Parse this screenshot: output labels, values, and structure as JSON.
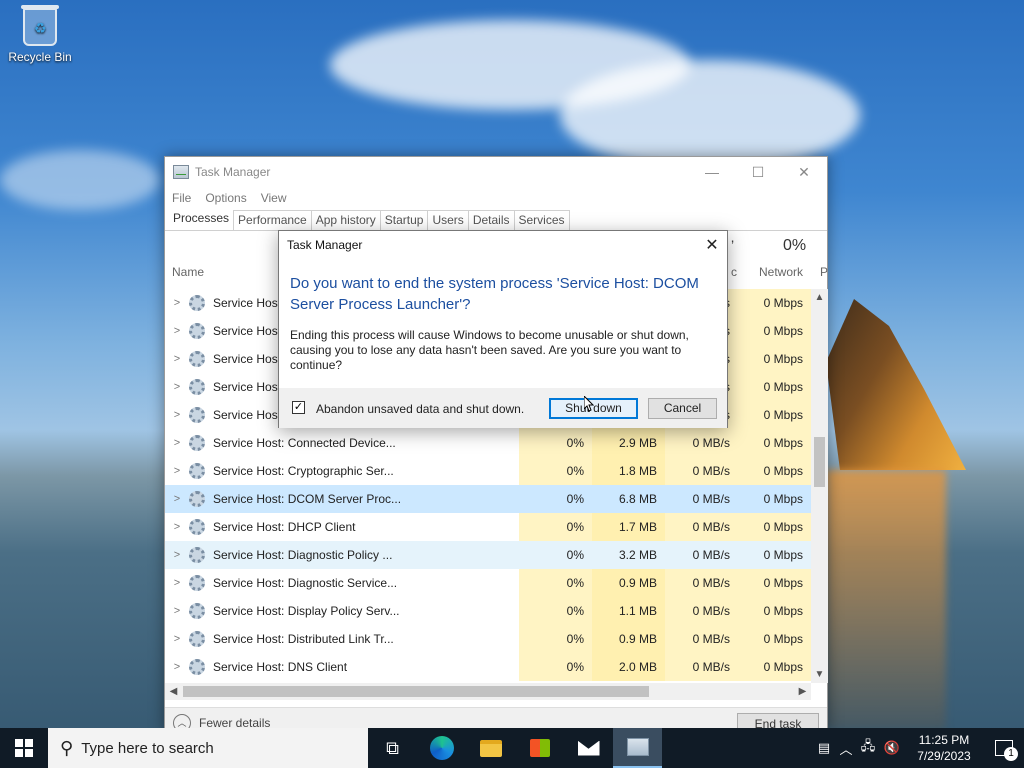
{
  "desktop": {
    "icons": [
      {
        "label": "Recycle Bin",
        "icon": "recycle-bin-icon"
      }
    ]
  },
  "task_manager": {
    "title": "Task Manager",
    "menu": [
      "File",
      "Options",
      "View"
    ],
    "tabs": [
      "Processes",
      "Performance",
      "App history",
      "Startup",
      "Users",
      "Details",
      "Services"
    ],
    "active_tab": "Processes",
    "header": {
      "name_col": "Name",
      "cpu_frag": "’",
      "disk_frag": "c",
      "network_pct": "0%",
      "network_col": "Network",
      "next_col_frag": "P"
    },
    "rows": [
      {
        "name": "Service Host",
        "cpu": "",
        "mem": "",
        "disk": "s",
        "net": "0 Mbps"
      },
      {
        "name": "Service Host",
        "cpu": "",
        "mem": "",
        "disk": "s",
        "net": "0 Mbps"
      },
      {
        "name": "Service Host",
        "cpu": "",
        "mem": "",
        "disk": "s",
        "net": "0 Mbps"
      },
      {
        "name": "Service Host",
        "cpu": "",
        "mem": "",
        "disk": "s",
        "net": "0 Mbps"
      },
      {
        "name": "Service Host",
        "cpu": "",
        "mem": "",
        "disk": "s",
        "net": "0 Mbps"
      },
      {
        "name": "Service Host: Connected Device...",
        "cpu": "0%",
        "mem": "2.9 MB",
        "disk": "0 MB/s",
        "net": "0 Mbps"
      },
      {
        "name": "Service Host: Cryptographic Ser...",
        "cpu": "0%",
        "mem": "1.8 MB",
        "disk": "0 MB/s",
        "net": "0 Mbps"
      },
      {
        "name": "Service Host: DCOM Server Proc...",
        "cpu": "0%",
        "mem": "6.8 MB",
        "disk": "0 MB/s",
        "net": "0 Mbps"
      },
      {
        "name": "Service Host: DHCP Client",
        "cpu": "0%",
        "mem": "1.7 MB",
        "disk": "0 MB/s",
        "net": "0 Mbps"
      },
      {
        "name": "Service Host: Diagnostic Policy ...",
        "cpu": "0%",
        "mem": "3.2 MB",
        "disk": "0 MB/s",
        "net": "0 Mbps"
      },
      {
        "name": "Service Host: Diagnostic Service...",
        "cpu": "0%",
        "mem": "0.9 MB",
        "disk": "0 MB/s",
        "net": "0 Mbps"
      },
      {
        "name": "Service Host: Display Policy Serv...",
        "cpu": "0%",
        "mem": "1.1 MB",
        "disk": "0 MB/s",
        "net": "0 Mbps"
      },
      {
        "name": "Service Host: Distributed Link Tr...",
        "cpu": "0%",
        "mem": "0.9 MB",
        "disk": "0 MB/s",
        "net": "0 Mbps"
      },
      {
        "name": "Service Host: DNS Client",
        "cpu": "0%",
        "mem": "2.0 MB",
        "disk": "0 MB/s",
        "net": "0 Mbps"
      }
    ],
    "footer": {
      "fewer_details": "Fewer details",
      "end_task": "End task"
    }
  },
  "dialog": {
    "title": "Task Manager",
    "main_instruction": "Do you want to end the system process 'Service Host: DCOM Server Process Launcher'?",
    "content": "Ending this process will cause Windows to become unusable or shut down, causing you to lose any data hasn't been saved. Are you sure you want to continue?",
    "checkbox_label": "Abandon unsaved data and shut down.",
    "checkbox_checked": true,
    "shutdown_label": "Shut down",
    "cancel_label": "Cancel"
  },
  "taskbar": {
    "search_placeholder": "Type here to search",
    "time": "11:25 PM",
    "date": "7/29/2023",
    "notification_count": "1"
  }
}
